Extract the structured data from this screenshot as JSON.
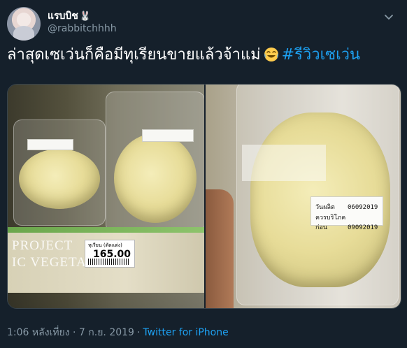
{
  "tweet": {
    "author": {
      "display_name": "แรบบิช",
      "display_emoji": "🐰",
      "handle": "@rabbitchhhh"
    },
    "text": "ล่าสุดเซเว่นก็คือมีทุเรียนขายแล้วจ้าแม่",
    "emoji": "😂",
    "hashtag": "#รีวิวเซเว่น",
    "timestamp": "1:06 หลังเที่ยง · 7 ก.ย. 2019",
    "source": "Twitter for iPhone",
    "icons": {
      "menu": "chevron-down-icon",
      "face": "face-with-tears-of-joy"
    }
  },
  "media": {
    "left_photo": {
      "price_label_name": "ทุเรียน (ตัดแต่ง)",
      "price_value": "165.00",
      "shelf_sign_line1": "PROJECT",
      "shelf_sign_line2": "IC VEGETA"
    },
    "right_photo": {
      "date_sticker": {
        "produced_label": "วันผลิต",
        "produced_value": "06092019",
        "best_before_label": "ควรบริโภคก่อน",
        "best_before_value": "09092019"
      }
    }
  },
  "colors": {
    "background": "#15202b",
    "text_primary": "#ffffff",
    "text_secondary": "#8899a6",
    "accent": "#1da1f2"
  }
}
